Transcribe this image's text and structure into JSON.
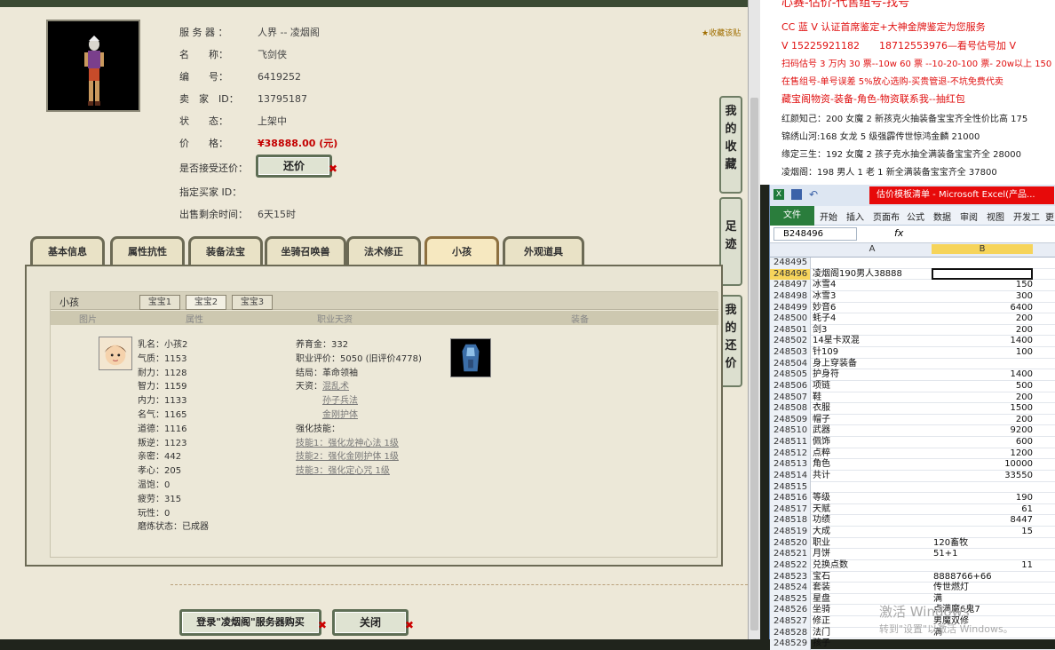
{
  "game": {
    "collect_tag": "收藏该贴",
    "seller": {
      "server_label": "服 务 器 ：",
      "server": "人界 -- 凌烟阁",
      "name_label": "名　　称：",
      "name": "飞剑侠",
      "id_label": "编　　号：",
      "id": "6419252",
      "seller_label": "卖　家　ID：",
      "seller_id": "13795187",
      "status_label": "状　　态：",
      "status": "上架中",
      "price_label": "价　　格：",
      "price": "¥38888.00 (元)",
      "bargain_label": "是否接受还价：",
      "bargain_button": "还价",
      "buyer_label": "指定买家 ID：",
      "time_label": "出售剩余时间：",
      "time_left": "6天15时"
    },
    "side_buttons": [
      "我的收藏",
      "足迹",
      "我的还价"
    ],
    "tabs": [
      "基本信息",
      "属性抗性",
      "装备法宝",
      "坐骑召唤兽",
      "法术修正",
      "小孩",
      "外观道具"
    ],
    "active_tab": "小孩",
    "kid_panel": {
      "title": "小孩",
      "sub_tabs": [
        "宝宝1",
        "宝宝2",
        "宝宝3"
      ],
      "columns": [
        "图片",
        "属性",
        "职业天资",
        "装备"
      ],
      "stats": [
        "乳名：小孩2",
        "气质：1153",
        "耐力：1128",
        "智力：1159",
        "内力：1133",
        "名气：1165",
        "道德：1116",
        "叛逆：1123",
        "亲密：442",
        "孝心：205",
        "温饱：0",
        "疲劳：315",
        "玩性：0",
        "磨炼状态：已成器"
      ],
      "career": {
        "fee": "养育金：332",
        "score": "职业评价：5050 (旧评价4778)",
        "ending": "结局：革命领袖",
        "talent_label": "天资：",
        "talents": [
          "混乱术",
          "孙子兵法",
          "金刚护体"
        ],
        "skills_label": "强化技能：",
        "skills": [
          "技能1：强化龙神心法 1级",
          "技能2：强化金刚护体 1级",
          "技能3：强化定心咒 1级"
        ]
      }
    },
    "bottom_buttons": [
      "登录\"凌烟阁\"服务器购买",
      "关闭"
    ]
  },
  "ad": {
    "lines": [
      "心赛-估价-代售组号-找号",
      "CC 蓝 V 认证首席鉴定+大神金牌鉴定为您服务",
      "V 15225921182　　18712553976—看号估号加 V",
      "扫码估号 3 万内 30 票--10w 60 票 --10-20-100 票- 20w以上 150",
      "在售组号-单号误差 5%放心选购-买贵管退-不坑免费代卖",
      "藏宝阁物资-装备-角色-物资联系我--抽红包",
      "红颜知己：200 女魔 2 新孩克火抽装备宝宝齐全性价比高 175",
      "锦绣山河:168 女龙 5 级强霹传世惊鸿金麟 21000",
      "缘定三生：192 女魔 2 孩子克水抽全满装备宝宝齐全 28000",
      "凌烟阁：198 男人 1 老 1 新全满装备宝宝齐全 37800"
    ]
  },
  "excel": {
    "title": "估价模板清单 - Microsoft Excel(产品...",
    "ribbon": [
      "文件",
      "开始",
      "插入",
      "页面布",
      "公式",
      "数据",
      "审阅",
      "视图",
      "开发工",
      "更"
    ],
    "name_box": "B248496",
    "fx": "fx",
    "col_a": "A",
    "col_b": "B",
    "rows": [
      {
        "n": "248495",
        "a": "",
        "b": ""
      },
      {
        "n": "248496",
        "a": "凌烟阁190男人38888",
        "b": ""
      },
      {
        "n": "248497",
        "a": "冰雪4",
        "b": "150"
      },
      {
        "n": "248498",
        "a": "冰雪3",
        "b": "300"
      },
      {
        "n": "248499",
        "a": "妙音6",
        "b": "6400"
      },
      {
        "n": "248500",
        "a": "蚝子4",
        "b": "200"
      },
      {
        "n": "248501",
        "a": "剑3",
        "b": "200"
      },
      {
        "n": "248502",
        "a": "14星卡双混",
        "b": "1400"
      },
      {
        "n": "248503",
        "a": "针109",
        "b": "100"
      },
      {
        "n": "248504",
        "a": "身上穿装备",
        "b": ""
      },
      {
        "n": "248505",
        "a": "护身符",
        "b": "1400"
      },
      {
        "n": "248506",
        "a": "项链",
        "b": "500"
      },
      {
        "n": "248507",
        "a": "鞋",
        "b": "200"
      },
      {
        "n": "248508",
        "a": "衣服",
        "b": "1500"
      },
      {
        "n": "248509",
        "a": "帽子",
        "b": "200"
      },
      {
        "n": "248510",
        "a": "武器",
        "b": "9200"
      },
      {
        "n": "248511",
        "a": "佩饰",
        "b": "600"
      },
      {
        "n": "248512",
        "a": "点粹",
        "b": "1200"
      },
      {
        "n": "248513",
        "a": "角色",
        "b": "10000"
      },
      {
        "n": "248514",
        "a": "共计",
        "b": "33550"
      },
      {
        "n": "248515",
        "a": "",
        "b": ""
      },
      {
        "n": "248516",
        "a": "等级",
        "b": "190"
      },
      {
        "n": "248517",
        "a": "天赋",
        "b": "61"
      },
      {
        "n": "248518",
        "a": "功绩",
        "b": "8447"
      },
      {
        "n": "248519",
        "a": "大成",
        "b": "15"
      },
      {
        "n": "248520",
        "a": "职业",
        "b": "120畜牧",
        "text": true
      },
      {
        "n": "248521",
        "a": "月饼",
        "b": "51+1",
        "text": true
      },
      {
        "n": "248522",
        "a": "兑换点数",
        "b": "11"
      },
      {
        "n": "248523",
        "a": "宝石",
        "b": "8888766+66",
        "text": true
      },
      {
        "n": "248524",
        "a": "套装",
        "b": "传世燃灯",
        "text": true
      },
      {
        "n": "248525",
        "a": "星盘",
        "b": "满",
        "text": true
      },
      {
        "n": "248526",
        "a": "坐骑",
        "b": "点满魔6鬼7",
        "text": true
      },
      {
        "n": "248527",
        "a": "修正",
        "b": "男魔双修",
        "text": true
      },
      {
        "n": "248528",
        "a": "法门",
        "b": "满",
        "text": true
      },
      {
        "n": "248529",
        "a": "孩子",
        "b": "",
        "text": true
      }
    ]
  },
  "watermark": [
    "激活 Windows",
    "转到\"设置\"以激活 Windows。"
  ]
}
